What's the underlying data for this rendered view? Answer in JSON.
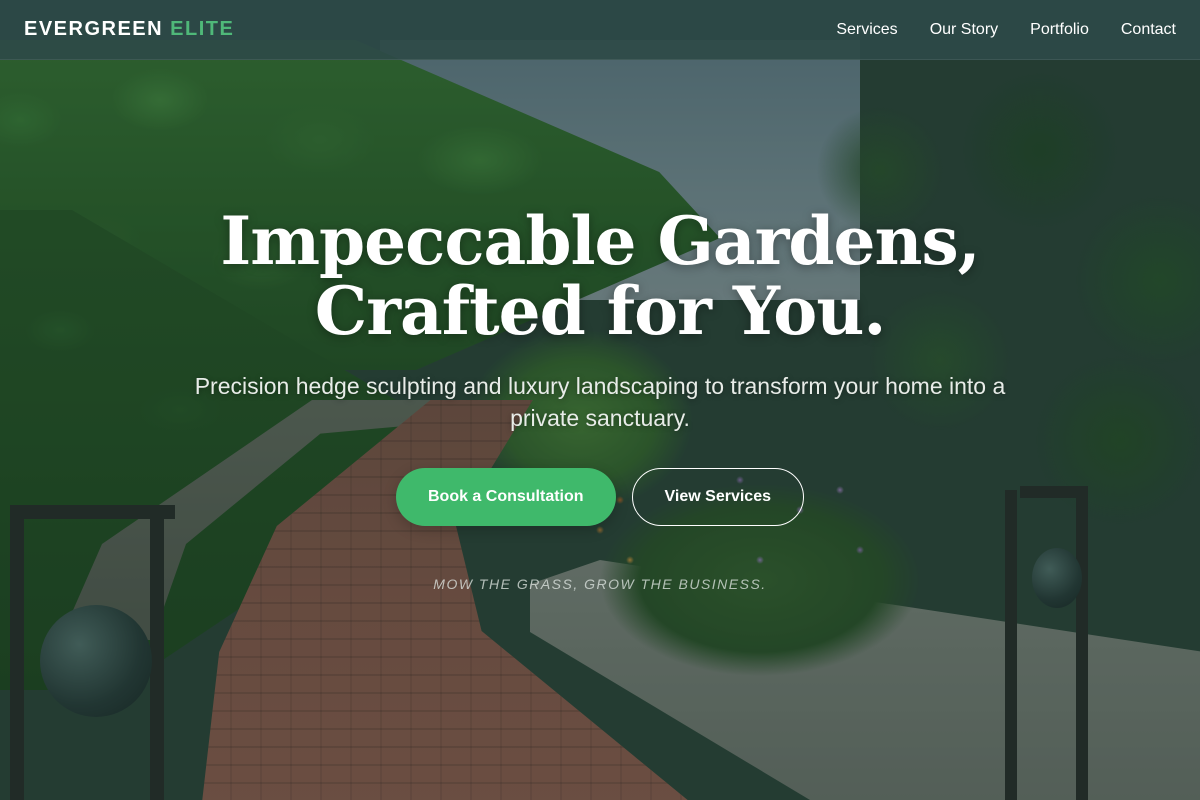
{
  "brand": {
    "name_primary": "EVERGREEN",
    "name_accent": "ELITE",
    "accent_color": "#4fb879"
  },
  "nav": {
    "items": [
      {
        "label": "Services"
      },
      {
        "label": "Our Story"
      },
      {
        "label": "Portfolio"
      },
      {
        "label": "Contact"
      }
    ]
  },
  "hero": {
    "title_line1": "Impeccable Gardens,",
    "title_line2": "Crafted for You.",
    "subtitle": "Precision hedge sculpting and luxury landscaping to transform your home into a private sanctuary.",
    "primary_cta": "Book a Consultation",
    "secondary_cta": "View Services",
    "tagline": "Mow the grass, grow the business.",
    "primary_color": "#3fb96b"
  },
  "background": {
    "image": "garden-path-photo"
  }
}
